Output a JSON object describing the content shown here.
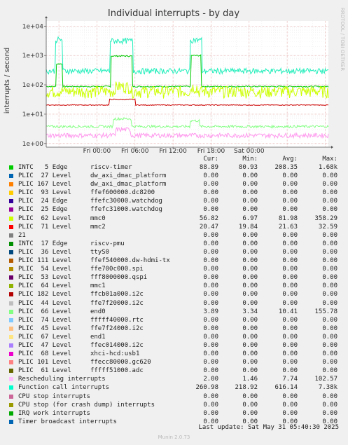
{
  "chart_data": {
    "type": "line",
    "title": "Individual interrupts - by day",
    "ylabel": "interrupts / second",
    "yscale": "log",
    "ylim": [
      0.75,
      15000
    ],
    "xlim": [
      -8,
      36.5
    ],
    "yticks": [
      {
        "v": 1,
        "label": "1e+00"
      },
      {
        "v": 10,
        "label": "1e+01"
      },
      {
        "v": 100,
        "label": "1e+02"
      },
      {
        "v": 1000,
        "label": "1e+03"
      },
      {
        "v": 10000,
        "label": "1e+04"
      }
    ],
    "xticks": [
      {
        "h": 0,
        "label": "Fri 00:00"
      },
      {
        "h": 6,
        "label": "Fri 06:00"
      },
      {
        "h": 12,
        "label": "Fri 12:00"
      },
      {
        "h": 18,
        "label": "Fri 18:00"
      },
      {
        "h": 24,
        "label": "Sat 00:00"
      }
    ],
    "grid": true,
    "series": [
      {
        "name": "riscv-timer",
        "color": "#00cc00",
        "baseline": 88,
        "bursts": [
          {
            "s": -6.4,
            "e": -5.5,
            "v": 520
          },
          {
            "s": 2.2,
            "e": 5.6,
            "v": 960
          },
          {
            "s": 14.8,
            "e": 16.4,
            "v": 1000
          }
        ],
        "jitter": 0.05
      },
      {
        "name": "mmc0",
        "color": "#ccff00",
        "baseline": 62,
        "bursts": [
          {
            "s": 2.8,
            "e": 5.3,
            "v": 90
          },
          {
            "s": 14.8,
            "e": 15.8,
            "v": 85
          }
        ],
        "jitter": 0.45
      },
      {
        "name": "mmc2",
        "color": "#cc0000",
        "baseline": 20.5,
        "bursts": [
          {
            "s": 1.9,
            "e": 6.0,
            "v": 32
          }
        ],
        "jitter": 0.03
      },
      {
        "name": "end0",
        "color": "#88ff88",
        "baseline": 3.8,
        "bursts": [
          {
            "s": 2.6,
            "e": 5.4,
            "v": 7
          },
          {
            "s": 14.7,
            "e": 16.2,
            "v": 6
          }
        ],
        "jitter": 0.1
      },
      {
        "name": "Rescheduling interrupts",
        "color": "#ff99ee",
        "baseline": 1.9,
        "bursts": [
          {
            "s": 3.0,
            "e": 5.3,
            "v": 3
          }
        ],
        "jitter": 0.18
      },
      {
        "name": "Function call interrupts",
        "color": "#22eebb",
        "baseline": 300,
        "bursts": [
          {
            "s": -6.5,
            "e": -5.5,
            "v": 3500
          },
          {
            "s": 2.1,
            "e": 5.7,
            "v": 3200
          },
          {
            "s": 14.7,
            "e": 16.5,
            "v": 3400
          }
        ],
        "jitter": 0.22
      }
    ]
  },
  "legend": {
    "headers": {
      "cur": "Cur:",
      "min": "Min:",
      "avg": "Avg:",
      "max": "Max:"
    },
    "rows": [
      {
        "label": "INTC   5 Edge      riscv-timer",
        "color": "#00cc00",
        "cur": "88.89",
        "min": "80.93",
        "avg": "208.35",
        "max": "1.68k"
      },
      {
        "label": "PLIC  27 Level     dw_axi_dmac_platform",
        "color": "#0066b3",
        "cur": "0.00",
        "min": "0.00",
        "avg": "0.00",
        "max": "0.00"
      },
      {
        "label": "PLIC 167 Level     dw_axi_dmac_platform",
        "color": "#ff8000",
        "cur": "0.00",
        "min": "0.00",
        "avg": "0.00",
        "max": "0.00"
      },
      {
        "label": "PLIC  93 Level     ffef600000.dc8200",
        "color": "#ffcc00",
        "cur": "0.00",
        "min": "0.00",
        "avg": "0.00",
        "max": "0.00"
      },
      {
        "label": "PLIC  24 Edge      ffefc30000.watchdog",
        "color": "#330099",
        "cur": "0.00",
        "min": "0.00",
        "avg": "0.00",
        "max": "0.00"
      },
      {
        "label": "PLIC  25 Edge      ffefc31000.watchdog",
        "color": "#990099",
        "cur": "0.00",
        "min": "0.00",
        "avg": "0.00",
        "max": "0.00"
      },
      {
        "label": "PLIC  62 Level     mmc0",
        "color": "#ccff00",
        "cur": "56.82",
        "min": "6.97",
        "avg": "81.98",
        "max": "358.29"
      },
      {
        "label": "PLIC  71 Level     mmc2",
        "color": "#ff0000",
        "cur": "20.47",
        "min": "19.84",
        "avg": "21.63",
        "max": "32.59"
      },
      {
        "label": "21",
        "color": "#808080",
        "cur": "0.00",
        "min": "0.00",
        "avg": "0.00",
        "max": "0.00"
      },
      {
        "label": "INTC  17 Edge      riscv-pmu",
        "color": "#008f00",
        "cur": "0.00",
        "min": "0.00",
        "avg": "0.00",
        "max": "0.00"
      },
      {
        "label": "PLIC  36 Level     ttyS0",
        "color": "#00487d",
        "cur": "0.00",
        "min": "0.00",
        "avg": "0.00",
        "max": "0.00"
      },
      {
        "label": "PLIC 111 Level     ffef540000.dw-hdmi-tx",
        "color": "#b35a00",
        "cur": "0.00",
        "min": "0.00",
        "avg": "0.00",
        "max": "0.00"
      },
      {
        "label": "PLIC  54 Level     ffe700c000.spi",
        "color": "#b38f00",
        "cur": "0.00",
        "min": "0.00",
        "avg": "0.00",
        "max": "0.00"
      },
      {
        "label": "PLIC  53 Level     fff8000000.qspi",
        "color": "#6b006b",
        "cur": "0.00",
        "min": "0.00",
        "avg": "0.00",
        "max": "0.00"
      },
      {
        "label": "PLIC  64 Level     mmc1",
        "color": "#8fb300",
        "cur": "0.00",
        "min": "0.00",
        "avg": "0.00",
        "max": "0.00"
      },
      {
        "label": "PLIC 182 Level     ffcb01a000.i2c",
        "color": "#b30000",
        "cur": "0.00",
        "min": "0.00",
        "avg": "0.00",
        "max": "0.00"
      },
      {
        "label": "PLIC  44 Level     ffe7f20000.i2c",
        "color": "#bebebe",
        "cur": "0.00",
        "min": "0.00",
        "avg": "0.00",
        "max": "0.00"
      },
      {
        "label": "PLIC  66 Level     end0",
        "color": "#80ff80",
        "cur": "3.89",
        "min": "3.34",
        "avg": "10.41",
        "max": "155.78"
      },
      {
        "label": "PLIC  74 Level     fffff40000.rtc",
        "color": "#80c9ff",
        "cur": "0.00",
        "min": "0.00",
        "avg": "0.00",
        "max": "0.00"
      },
      {
        "label": "PLIC  45 Level     ffe7f24000.i2c",
        "color": "#ffc080",
        "cur": "0.00",
        "min": "0.00",
        "avg": "0.00",
        "max": "0.00"
      },
      {
        "label": "PLIC  67 Level     end1",
        "color": "#ffe680",
        "cur": "0.00",
        "min": "0.00",
        "avg": "0.00",
        "max": "0.00"
      },
      {
        "label": "PLIC  47 Level     ffec014000.i2c",
        "color": "#aa80ff",
        "cur": "0.00",
        "min": "0.00",
        "avg": "0.00",
        "max": "0.00"
      },
      {
        "label": "PLIC  68 Level     xhci-hcd:usb1",
        "color": "#ee00cc",
        "cur": "0.00",
        "min": "0.00",
        "avg": "0.00",
        "max": "0.00"
      },
      {
        "label": "PLIC 101 Level     ffecc80000.gc620",
        "color": "#ff8080",
        "cur": "0.00",
        "min": "0.00",
        "avg": "0.00",
        "max": "0.00"
      },
      {
        "label": "PLIC  61 Level     fffff51000.adc",
        "color": "#666600",
        "cur": "0.00",
        "min": "0.00",
        "avg": "0.00",
        "max": "0.00"
      },
      {
        "label": "Rescheduling interrupts",
        "color": "#ffbfff",
        "cur": "2.00",
        "min": "1.46",
        "avg": "7.74",
        "max": "102.57"
      },
      {
        "label": "Function call interrupts",
        "color": "#00ffcc",
        "cur": "260.98",
        "min": "218.92",
        "avg": "616.14",
        "max": "7.38k"
      },
      {
        "label": "CPU stop interrupts",
        "color": "#cc6699",
        "cur": "0.00",
        "min": "0.00",
        "avg": "0.00",
        "max": "0.00"
      },
      {
        "label": "CPU stop (for crash dump) interrupts",
        "color": "#999900",
        "cur": "0.00",
        "min": "0.00",
        "avg": "0.00",
        "max": "0.00"
      },
      {
        "label": "IRQ work interrupts",
        "color": "#00aa00",
        "cur": "0.00",
        "min": "0.00",
        "avg": "0.00",
        "max": "0.00"
      },
      {
        "label": "Timer broadcast interrupts",
        "color": "#0066b3",
        "cur": "0.00",
        "min": "0.00",
        "avg": "0.00",
        "max": "0.00"
      }
    ]
  },
  "side_text": "RRDTOOL / TOBI OETIKER",
  "footer": "Last update: Sat May 31 05:40:30 2025",
  "munin": "Munin 2.0.73"
}
